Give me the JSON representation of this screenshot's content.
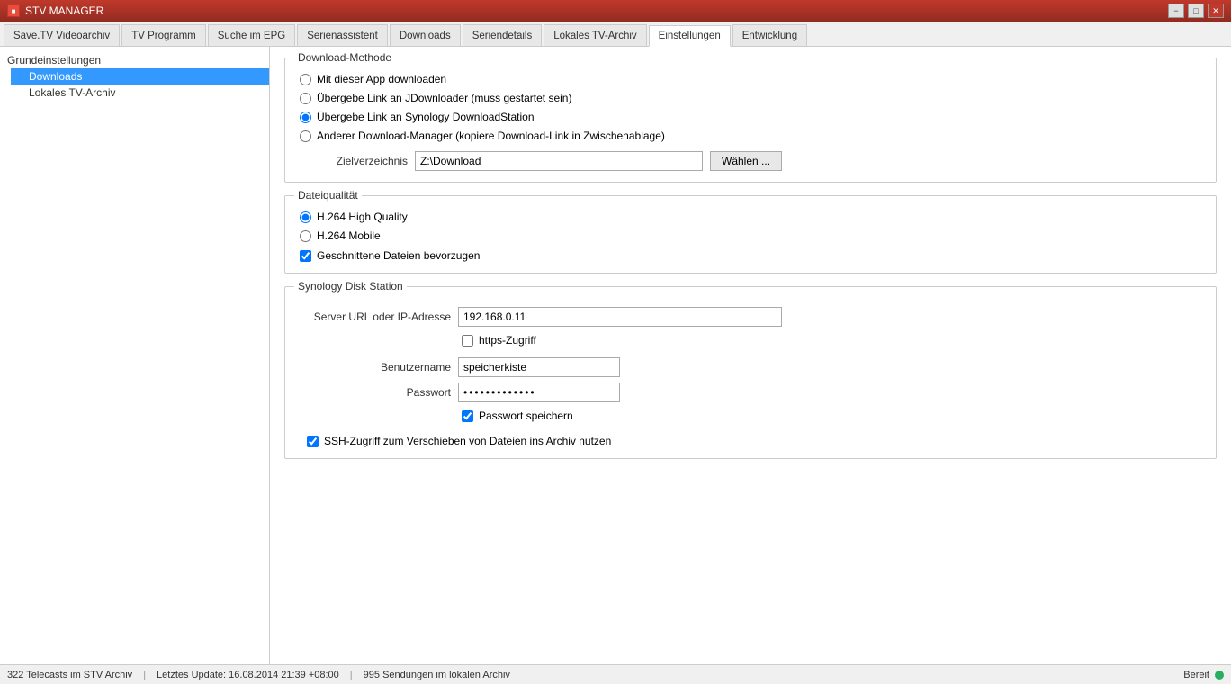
{
  "titlebar": {
    "title": "STV MANAGER",
    "icon_label": "STV",
    "minimize": "−",
    "maximize": "□",
    "close": "✕"
  },
  "tabs": [
    {
      "id": "savetv",
      "label": "Save.TV Videoarchiv"
    },
    {
      "id": "tvprog",
      "label": "TV Programm"
    },
    {
      "id": "search",
      "label": "Suche im EPG"
    },
    {
      "id": "serienassistent",
      "label": "Serienassistent"
    },
    {
      "id": "downloads",
      "label": "Downloads"
    },
    {
      "id": "seriendetails",
      "label": "Seriendetails"
    },
    {
      "id": "lokales",
      "label": "Lokales TV-Archiv"
    },
    {
      "id": "einstellungen",
      "label": "Einstellungen",
      "active": true
    },
    {
      "id": "entwicklung",
      "label": "Entwicklung"
    }
  ],
  "sidebar": {
    "items": [
      {
        "id": "grundeinstellungen",
        "label": "Grundeinstellungen",
        "level": "root",
        "selected": false
      },
      {
        "id": "downloads",
        "label": "Downloads",
        "level": "child",
        "selected": true
      },
      {
        "id": "lokales-archiv",
        "label": "Lokales TV-Archiv",
        "level": "child",
        "selected": false
      }
    ]
  },
  "sections": {
    "download_method": {
      "title": "Download-Methode",
      "options": [
        {
          "id": "app",
          "label": "Mit dieser App downloaden",
          "selected": false
        },
        {
          "id": "jdownloader",
          "label": "Übergebe Link an JDownloader (muss gestartet sein)",
          "selected": false
        },
        {
          "id": "synology",
          "label": "Übergebe Link an Synology DownloadStation",
          "selected": true
        },
        {
          "id": "other",
          "label": "Anderer Download-Manager (kopiere Download-Link in Zwischenablage)",
          "selected": false
        }
      ],
      "zielverzeichnis_label": "Zielverzeichnis",
      "zielverzeichnis_value": "Z:\\Download",
      "waehlen_btn": "Wählen ..."
    },
    "dateiqualitaet": {
      "title": "Dateiqualität",
      "options": [
        {
          "id": "h264hq",
          "label": "H.264 High Quality",
          "selected": true
        },
        {
          "id": "h264mobile",
          "label": "H.264 Mobile",
          "selected": false
        }
      ],
      "checkbox_label": "Geschnittene Dateien bevorzugen",
      "checkbox_checked": true
    },
    "synology": {
      "title": "Synology Disk Station",
      "server_label": "Server URL oder IP-Adresse",
      "server_value": "192.168.0.11",
      "https_label": "https-Zugriff",
      "https_checked": false,
      "benutzername_label": "Benutzername",
      "benutzername_value": "speicherkiste",
      "passwort_label": "Passwort",
      "passwort_value": "••••••••••••••",
      "passwort_speichern_label": "Passwort speichern",
      "passwort_speichern_checked": true,
      "ssh_label": "SSH-Zugriff zum Verschieben von Dateien ins Archiv nutzen",
      "ssh_checked": true
    }
  },
  "statusbar": {
    "telecasts": "322 Telecasts im STV Archiv",
    "separator1": "|",
    "last_update": "Letztes Update: 16.08.2014 21:39 +08:00",
    "separator2": "|",
    "sendungen": "995 Sendungen im lokalen Archiv",
    "status_text": "Bereit"
  }
}
